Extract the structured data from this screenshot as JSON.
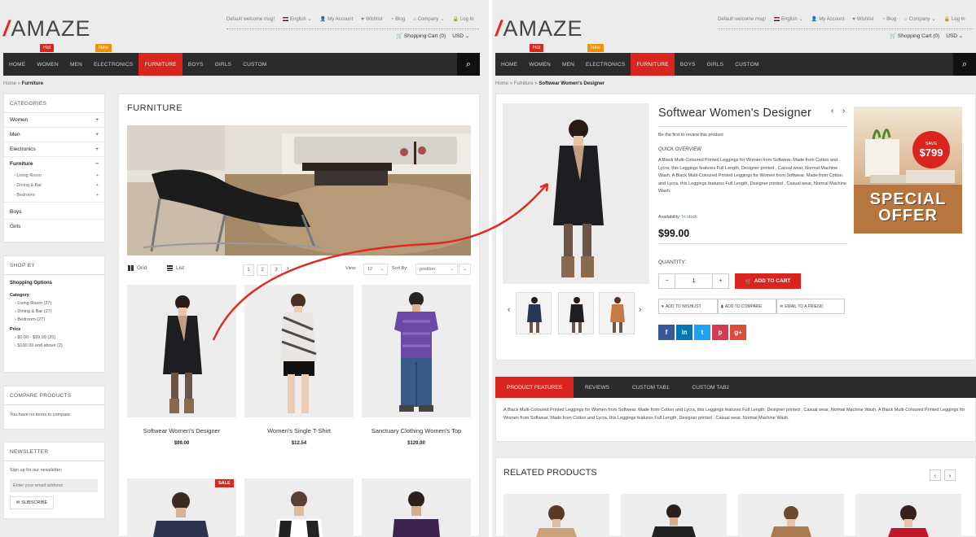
{
  "left": {
    "logo": "AMAZE",
    "toplinks": {
      "welcome": "Default welcome msg!",
      "language": "English",
      "account": "My Account",
      "wishlist": "Wishlist",
      "blog": "Blog",
      "company": "Company",
      "login": "Log In"
    },
    "cart": "Shopping Cart (0)",
    "currency": "USD",
    "nav": [
      "HOME",
      "WOMEN",
      "MEN",
      "ELECTRONICS",
      "FURNITURE",
      "BOYS",
      "GIRLS",
      "CUSTOM"
    ],
    "badges": {
      "hot": "Hot",
      "new": "New"
    },
    "breadcrumb": {
      "home": "Home",
      "sep": "»",
      "current": "Furniture"
    },
    "categories": {
      "title": "CATEGORIES",
      "items": [
        {
          "label": "Women",
          "sign": "+"
        },
        {
          "label": "Men",
          "sign": "+"
        },
        {
          "label": "Electronics",
          "sign": "+"
        },
        {
          "label": "Furniture",
          "sign": "−"
        }
      ],
      "sub": [
        {
          "label": "Living Room",
          "sign": "+"
        },
        {
          "label": "Dining & Bar",
          "sign": "+"
        },
        {
          "label": "Bedroom",
          "sign": "+"
        }
      ],
      "after": [
        "Boys",
        "Girls"
      ]
    },
    "shopby": {
      "title": "SHOP BY",
      "options": "Shopping Options",
      "category_label": "Category",
      "categories": [
        "Living Room (27)",
        "Dining & Bar (27)",
        "Bedroom (27)"
      ],
      "price_label": "Price",
      "prices": [
        "$0.00 - $99.99 (25)",
        "$100.00 and above (2)"
      ]
    },
    "compare": {
      "title": "COMPARE PRODUCTS",
      "text": "You have no items to compare."
    },
    "newsletter": {
      "title": "NEWSLETTER",
      "text": "Sign up for our newsletter:",
      "placeholder": "Enter your email address",
      "button": "SUBSCRIBE"
    },
    "main": {
      "heading": "FURNITURE",
      "grid": "Grid",
      "list": "List",
      "pages": [
        "1",
        "2",
        "3"
      ],
      "view_label": "View:",
      "view_value": "12",
      "sort_label": "Sort By:",
      "sort_value": "position",
      "products": [
        {
          "name": "Softwear Women's Designer",
          "price": "$99.00"
        },
        {
          "name": "Women's Single T-Shirt",
          "price": "$12.54"
        },
        {
          "name": "Sanctuary Clothing Women's Top",
          "price": "$129.00"
        }
      ],
      "sale": "SALE"
    }
  },
  "right": {
    "logo": "AMAZE",
    "toplinks": {
      "welcome": "Default welcome msg!",
      "language": "English",
      "account": "My Account",
      "wishlist": "Wishlist",
      "blog": "Blog",
      "company": "Company",
      "login": "Log In"
    },
    "cart": "Shopping Cart (0)",
    "currency": "USD",
    "nav": [
      "HOME",
      "WOMEN",
      "MEN",
      "ELECTRONICS",
      "FURNITURE",
      "BOYS",
      "GIRLS",
      "CUSTOM"
    ],
    "badges": {
      "hot": "Hot",
      "new": "New"
    },
    "breadcrumb": {
      "home": "Home",
      "sep": "»",
      "mid": "Furniture",
      "current": "Softwear Women's Designer"
    },
    "product": {
      "title": "Softwear Women's Designer",
      "review": "Be the first to review this product",
      "quick_title": "QUICK OVERVIEW",
      "quick_text": "A Black Multi-Coloured Printed Leggings for Women from Softwear. Made from Cotton and Lycra, this Leggings features Full Length, Designer printed , Casual wear, Normal Machine Wash. A Black Multi-Coloured Printed Leggings for Women from Softwear. Made from Cotton and Lycra, this Leggings features Full Length, Designer printed , Casual wear, Normal Machine Wash.",
      "availability_label": "Availability:",
      "availability_value": "In stock",
      "price": "$99.00",
      "quantity_label": "QUANTITY:",
      "qty": "1",
      "add_to_cart": "ADD TO CART",
      "wishlist": "ADD TO WISHLIST",
      "compare": "ADD TO COMPARE",
      "email": "EMAIL TO A FRIEND"
    },
    "promo": {
      "save": "SAVE",
      "amount": "$799",
      "line1": "SPECIAL",
      "line2": "OFFER"
    },
    "tabs": [
      "PRODUCT FEATURES",
      "REVIEWS",
      "CUSTOM TAB1",
      "CUSTOM TAB2"
    ],
    "features_text": "A Black Multi-Coloured Printed Leggings for Women from Softwear. Made from Cotton and Lycra, this Leggings features Full Length, Designer printed , Casual wear, Normal Machine Wash.  A Black Multi-Coloured Printed Leggings for Women from Softwear. Made from Cotton and Lycra, this Leggings features Full Length, Designer printed , Casual wear, Normal Machine Wash.",
    "related_title": "RELATED PRODUCTS"
  },
  "colors": {
    "accent": "#d9251d",
    "nav": "#2b2b2b",
    "new_badge": "#f29100",
    "arrow": "#e02a20"
  },
  "icons": [
    "search-icon",
    "cart-icon",
    "user-icon",
    "heart-icon",
    "rss-icon",
    "lock-icon",
    "grid-icon",
    "list-icon",
    "chevron-left-icon",
    "chevron-right-icon",
    "envelope-icon",
    "facebook-icon",
    "linkedin-icon",
    "twitter-icon",
    "pinterest-icon",
    "google-plus-icon"
  ]
}
